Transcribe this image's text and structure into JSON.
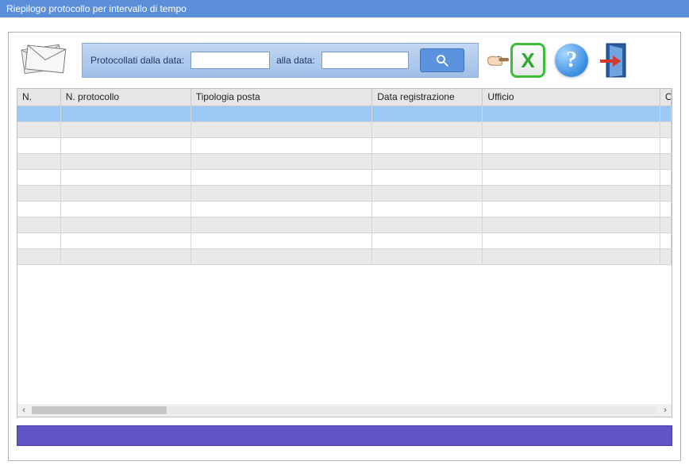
{
  "window": {
    "title": "Riepilogo protocollo per intervallo di tempo"
  },
  "filter": {
    "from_label": "Protocollati dalla data:",
    "to_label": "alla data:",
    "from_value": "",
    "to_value": ""
  },
  "icons": {
    "excel_glyph": "X",
    "help_glyph": "?"
  },
  "grid": {
    "columns": {
      "n": "N.",
      "np": "N. protocollo",
      "tp": "Tipologia posta",
      "dr": "Data registrazione",
      "uf": "Ufficio",
      "o": "O"
    },
    "row_count": 10
  },
  "status": {
    "text": ""
  }
}
